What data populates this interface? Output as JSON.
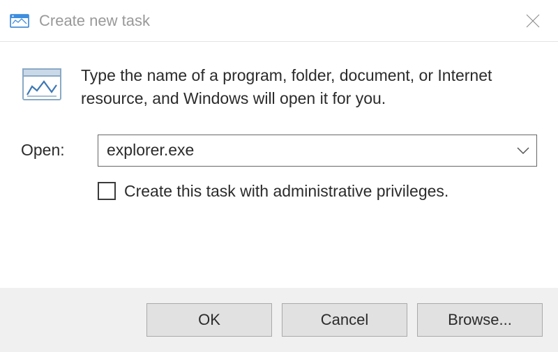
{
  "titlebar": {
    "title": "Create new task"
  },
  "body": {
    "prompt": "Type the name of a program, folder, document, or Internet resource, and Windows will open it for you.",
    "open_label": "Open:",
    "open_value": "explorer.exe",
    "admin_checkbox_label": "Create this task with administrative privileges.",
    "admin_checked": false
  },
  "footer": {
    "ok_label": "OK",
    "cancel_label": "Cancel",
    "browse_label": "Browse..."
  },
  "icons": {
    "titlebar": "run-app-icon",
    "run": "run-dialog-icon",
    "chevron": "chevron-down-icon",
    "close": "close-icon"
  }
}
